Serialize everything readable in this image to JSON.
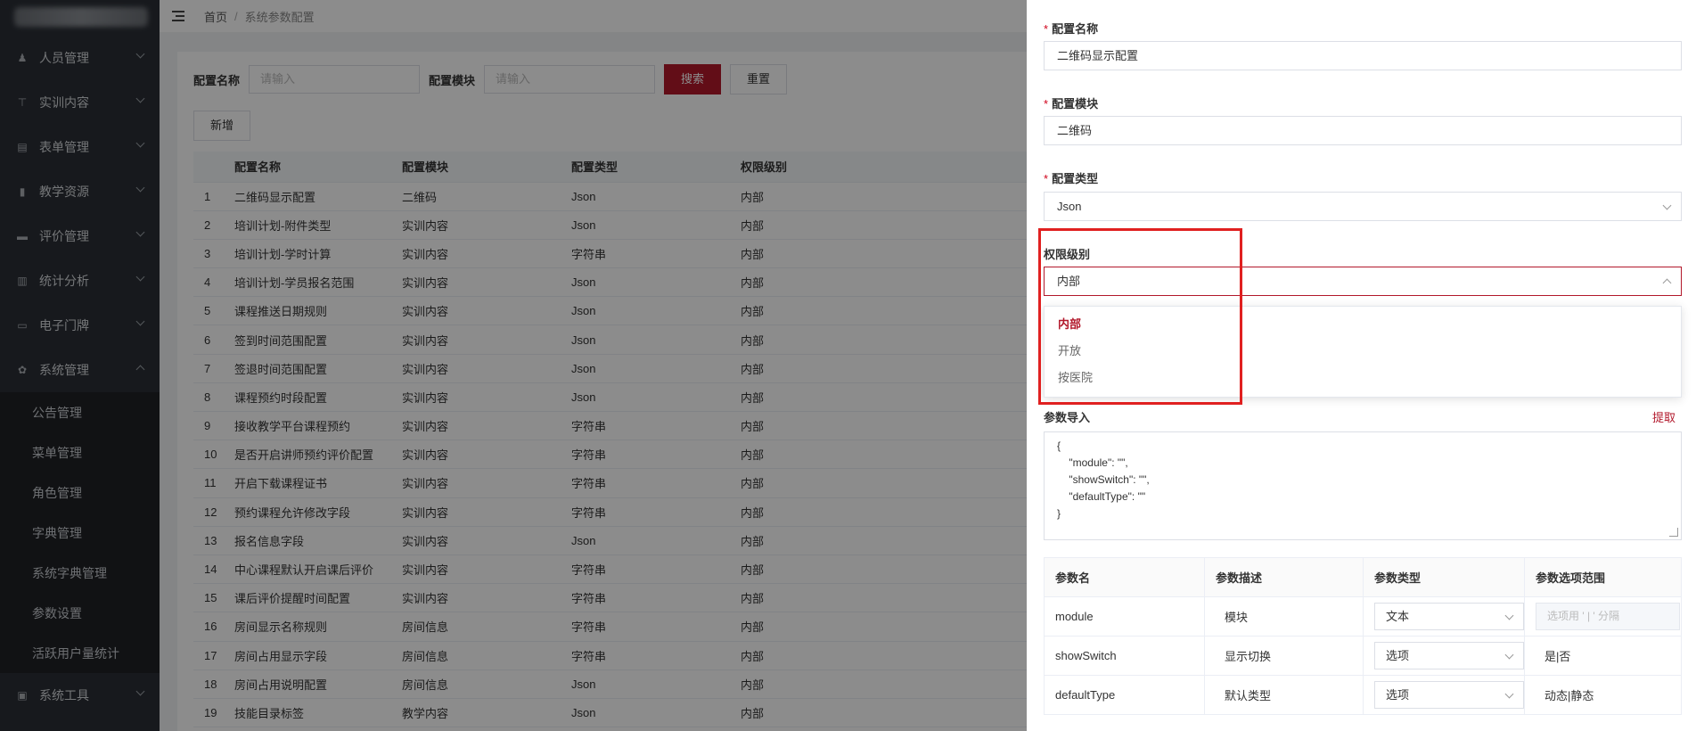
{
  "sidebar": {
    "items": [
      {
        "label": "人员管理",
        "icon": "users-icon"
      },
      {
        "label": "实训内容",
        "icon": "tree-icon"
      },
      {
        "label": "表单管理",
        "icon": "form-icon"
      },
      {
        "label": "教学资源",
        "icon": "book-icon"
      },
      {
        "label": "评价管理",
        "icon": "comment-icon"
      },
      {
        "label": "统计分析",
        "icon": "bar-chart-icon"
      },
      {
        "label": "电子门牌",
        "icon": "monitor-icon"
      },
      {
        "label": "系统管理",
        "icon": "gear-icon"
      }
    ],
    "sub_items": [
      "公告管理",
      "菜单管理",
      "角色管理",
      "字典管理",
      "系统字典管理",
      "参数设置",
      "活跃用户量统计"
    ],
    "bottom_item": {
      "label": "系统工具",
      "icon": "briefcase-icon"
    }
  },
  "breadcrumb": {
    "home": "首页",
    "sep": "/",
    "current": "系统参数配置"
  },
  "filter": {
    "name_label": "配置名称",
    "name_placeholder": "请输入",
    "module_label": "配置模块",
    "module_placeholder": "请输入",
    "search_button": "搜索",
    "reset_button": "重置",
    "add_button": "新增"
  },
  "table": {
    "headers": [
      "",
      "配置名称",
      "配置模块",
      "配置类型",
      "权限级别"
    ],
    "rows": [
      [
        "1",
        "二维码显示配置",
        "二维码",
        "Json",
        "内部"
      ],
      [
        "2",
        "培训计划-附件类型",
        "实训内容",
        "Json",
        "内部"
      ],
      [
        "3",
        "培训计划-学时计算",
        "实训内容",
        "字符串",
        "内部"
      ],
      [
        "4",
        "培训计划-学员报名范围",
        "实训内容",
        "Json",
        "内部"
      ],
      [
        "5",
        "课程推送日期规则",
        "实训内容",
        "Json",
        "内部"
      ],
      [
        "6",
        "签到时间范围配置",
        "实训内容",
        "Json",
        "内部"
      ],
      [
        "7",
        "签退时间范围配置",
        "实训内容",
        "Json",
        "内部"
      ],
      [
        "8",
        "课程预约时段配置",
        "实训内容",
        "Json",
        "内部"
      ],
      [
        "9",
        "接收教学平台课程预约",
        "实训内容",
        "字符串",
        "内部"
      ],
      [
        "10",
        "是否开启讲师预约评价配置",
        "实训内容",
        "字符串",
        "内部"
      ],
      [
        "11",
        "开启下载课程证书",
        "实训内容",
        "字符串",
        "内部"
      ],
      [
        "12",
        "预约课程允许修改字段",
        "实训内容",
        "字符串",
        "内部"
      ],
      [
        "13",
        "报名信息字段",
        "实训内容",
        "Json",
        "内部"
      ],
      [
        "14",
        "中心课程默认开启课后评价",
        "实训内容",
        "字符串",
        "内部"
      ],
      [
        "15",
        "课后评价提醒时间配置",
        "实训内容",
        "字符串",
        "内部"
      ],
      [
        "16",
        "房间显示名称规则",
        "房间信息",
        "字符串",
        "内部"
      ],
      [
        "17",
        "房间占用显示字段",
        "房间信息",
        "字符串",
        "内部"
      ],
      [
        "18",
        "房间占用说明配置",
        "房间信息",
        "Json",
        "内部"
      ],
      [
        "19",
        "技能目录标签",
        "教学内容",
        "Json",
        "内部"
      ]
    ]
  },
  "drawer": {
    "name_label": "配置名称",
    "name_value": "二维码显示配置",
    "module_label": "配置模块",
    "module_value": "二维码",
    "type_label": "配置类型",
    "type_value": "Json",
    "level_label": "权限级别",
    "level_value": "内部",
    "level_options": [
      "内部",
      "开放",
      "按医院"
    ],
    "param_import_label": "参数导入",
    "extract_link": "提取",
    "json_text": "{\n    \"module\": \"\",\n    \"showSwitch\": \"\",\n    \"defaultType\": \"\"\n}",
    "param_headers": [
      "参数名",
      "参数描述",
      "参数类型",
      "参数选项范围"
    ],
    "params": [
      {
        "name": "module",
        "desc": "模块",
        "type": "文本",
        "range": "",
        "range_placeholder": "选项用 ' | ' 分隔"
      },
      {
        "name": "showSwitch",
        "desc": "显示切换",
        "type": "选项",
        "range": "是|否"
      },
      {
        "name": "defaultType",
        "desc": "默认类型",
        "type": "选项",
        "range": "动态|静态"
      }
    ]
  },
  "colors": {
    "accent": "#b2182b",
    "sidebar_bg": "#2b2f36",
    "highlight": "#e02020"
  }
}
